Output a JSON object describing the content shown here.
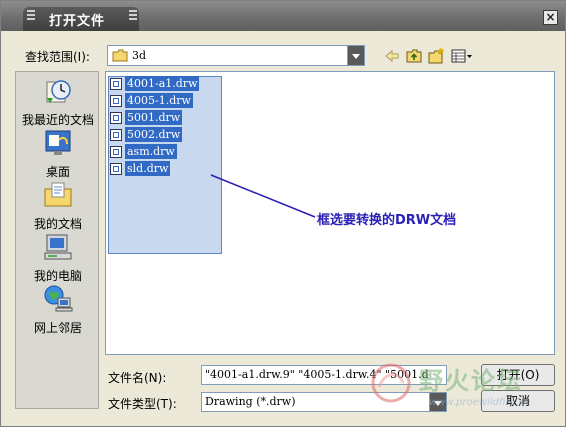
{
  "window": {
    "title": "打开文件",
    "close_symbol": "×",
    "frame_color": "#6b6b6b"
  },
  "lookin": {
    "label": "查找范围(I):",
    "value": "3d"
  },
  "toolbar": {
    "back_icon": "back-arrow-icon",
    "up_icon": "up-folder-icon",
    "newfolder_icon": "new-folder-icon",
    "view_icon": "view-menu-icon"
  },
  "places": [
    {
      "label": "我最近的文档",
      "icon": "recent-documents-icon"
    },
    {
      "label": "桌面",
      "icon": "desktop-icon"
    },
    {
      "label": "我的文档",
      "icon": "my-documents-icon"
    },
    {
      "label": "我的电脑",
      "icon": "my-computer-icon"
    },
    {
      "label": "网上邻居",
      "icon": "network-places-icon"
    }
  ],
  "files": [
    {
      "name": "4001-a1.drw"
    },
    {
      "name": "4005-1.drw"
    },
    {
      "name": "5001.drw"
    },
    {
      "name": "5002.drw"
    },
    {
      "name": "asm.drw"
    },
    {
      "name": "sld.drw"
    }
  ],
  "annotation": {
    "text": "框选要转换的DRW文档",
    "color": "#2a1fb5"
  },
  "filename": {
    "label": "文件名(N):",
    "value": "\"4001-a1.drw.9\" \"4005-1.drw.4\" \"5001.d"
  },
  "filetype": {
    "label": "文件类型(T):",
    "value": "Drawing (*.drw)"
  },
  "buttons": {
    "open": "打开(O)",
    "cancel": "取消"
  },
  "watermark": {
    "text": "野火论坛",
    "url": "www.proewildfire.cn"
  },
  "colors": {
    "selection": "#316ac5",
    "marquee_fill": "#c8d8ee",
    "dialog_bg": "#ece9d8"
  }
}
